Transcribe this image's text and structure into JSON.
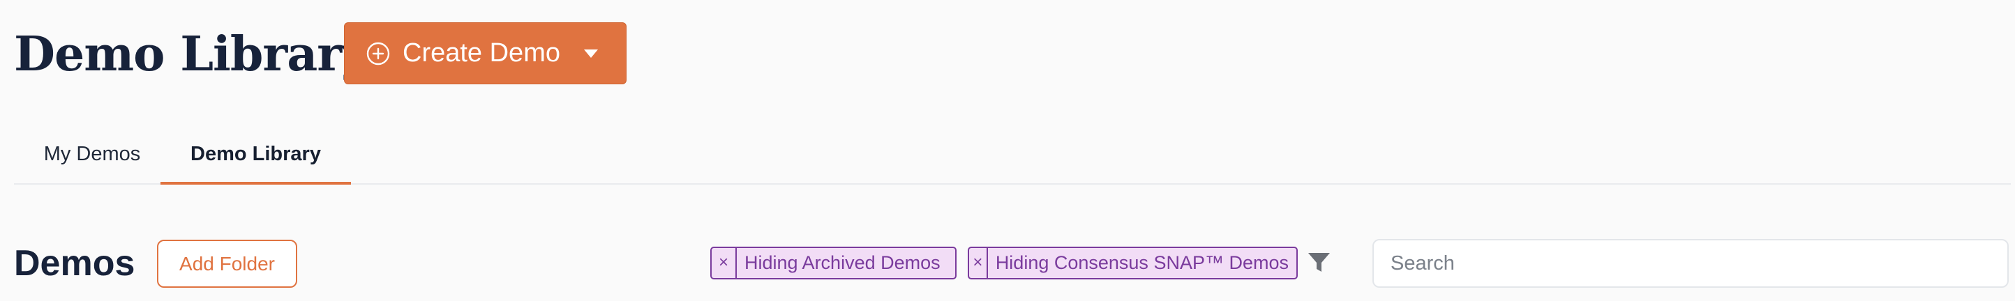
{
  "header": {
    "title": "Demo Library",
    "create_button": {
      "label": "Create Demo",
      "icon": "plus-circle-icon",
      "dropdown_icon": "caret-down-icon"
    }
  },
  "tabs": [
    {
      "label": "My Demos",
      "active": false
    },
    {
      "label": "Demo Library",
      "active": true
    }
  ],
  "section": {
    "title": "Demos",
    "add_folder_label": "Add Folder"
  },
  "filters": {
    "chips": [
      {
        "label": "Hiding Archived Demos",
        "remove_glyph": "×"
      },
      {
        "label": "Hiding Consensus SNAP™ Demos",
        "remove_glyph": "×"
      }
    ],
    "filter_icon": "funnel-icon"
  },
  "search": {
    "placeholder": "Search",
    "value": ""
  },
  "colors": {
    "accent": "#e07340",
    "chip_border": "#7a3b9d",
    "chip_background": "#f2ddf6",
    "title": "#17223a"
  }
}
